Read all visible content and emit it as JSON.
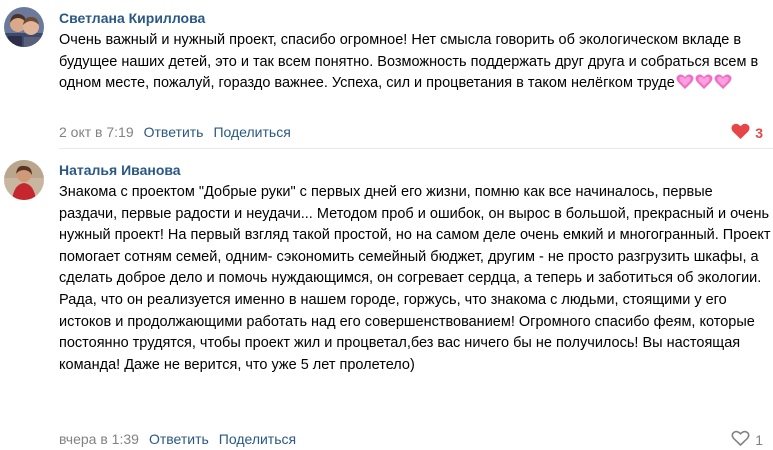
{
  "comments": [
    {
      "author": "Светлана Кириллова",
      "text": "Очень важный и нужный проект, спасибо огромное! Нет смысла говорить об экологическом вкладе в будущее наших детей, это и так всем понятно. Возможность поддержать друг друга и собраться всем в одном месте, пожалуй, гораздо важнее. Успеха, сил и процветания в таком нелёгком труде",
      "emoji": [
        "sparkling-heart",
        "sparkling-heart",
        "sparkling-heart"
      ],
      "time": "2 окт в 7:19",
      "reply_label": "Ответить",
      "share_label": "Поделиться",
      "likes": "3",
      "liked": true
    },
    {
      "author": "Наталья Иванова",
      "text": "Знакома с проектом \"Добрые руки\" с первых дней его жизни, помню как все начиналось, первые раздачи, первые радости и неудачи... Методом проб и ошибок, он вырос в большой, прекрасный и очень нужный проект! На первый взгляд такой простой, но на самом деле очень емкий и многогранный. Проект помогает сотням семей, одним- сэкономить семейный бюджет, другим - не просто разгрузить шкафы, а сделать доброе дело и помочь нуждающимся, он согревает сердца, а теперь и заботиться об экологии. Рада, что он реализуется именно в нашем городе, горжусь, что знакома с людьми, стоящими у его истоков и продолжающими работать над его совершенствованием! Огромного спасибо феям, которые постоянно трудятся, чтобы проект жил и процветал,без вас ничего бы не получилось! Вы настоящая команда! Даже не верится, что уже 5 лет пролетело)",
      "time": "вчера в 1:39",
      "reply_label": "Ответить",
      "share_label": "Поделиться",
      "likes": "1",
      "liked": false
    }
  ],
  "colors": {
    "link": "#2a5885",
    "meta": "#828282",
    "like_active": "#e64646",
    "divider": "#e7e8ec"
  }
}
